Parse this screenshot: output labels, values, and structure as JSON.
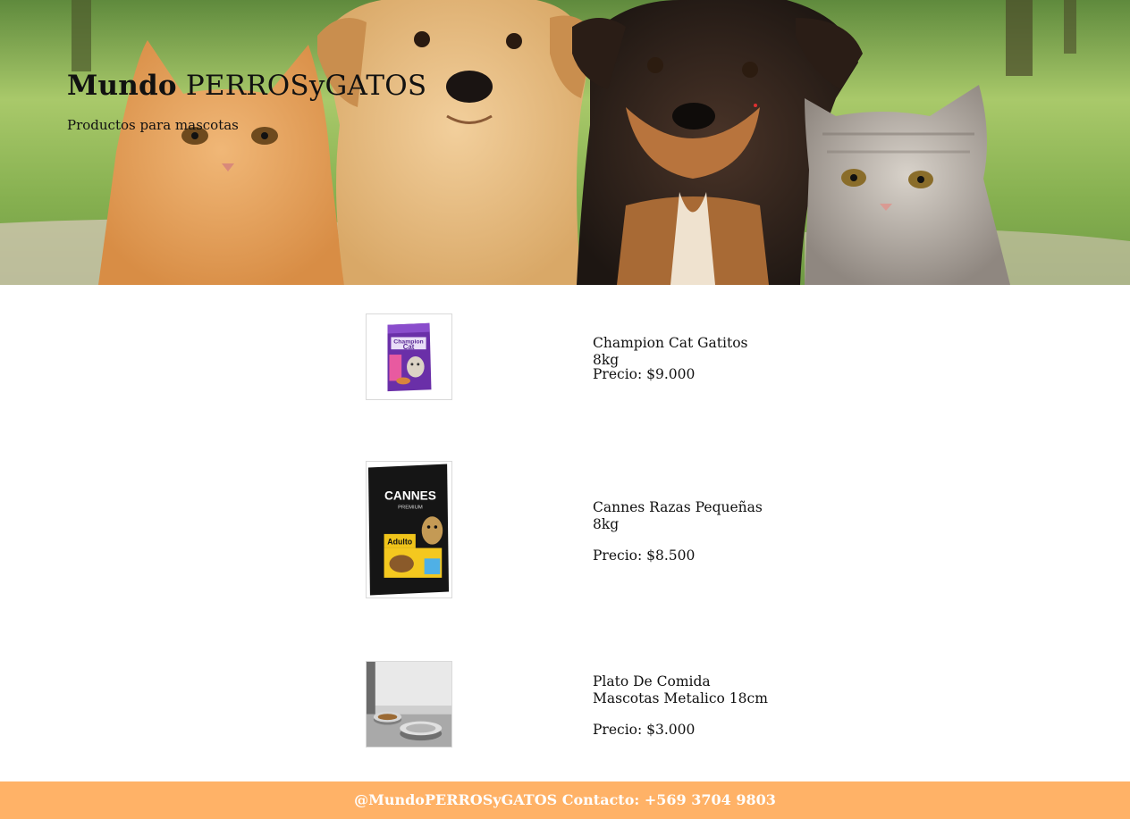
{
  "hero": {
    "title_bold": "Mundo",
    "title_rest": "PERROSyGATOS",
    "subtitle": "Productos para mascotas",
    "image": "puppies-and-kittens-photo"
  },
  "products": [
    {
      "name": "Champion Cat Gatitos 8kg",
      "price": "Precio: $9.000",
      "image": "champion-cat-bag",
      "image_text_1": "Champion",
      "image_text_2": "Cat"
    },
    {
      "name": "Cannes Razas Pequeñas 8kg",
      "price": "Precio: $8.500",
      "image": "cannes-premium-bag",
      "image_text_1": "CANNES",
      "image_text_2": "PREMIUM",
      "image_text_3": "Adulto"
    },
    {
      "name": "Plato De Comida Mascotas Metalico 18cm",
      "price": "Precio: $3.000",
      "image": "metal-food-bowls"
    }
  ],
  "footer": {
    "text": "@MundoPERROSyGATOS Contacto: +569 3704 9803",
    "background": "#ffb267"
  }
}
